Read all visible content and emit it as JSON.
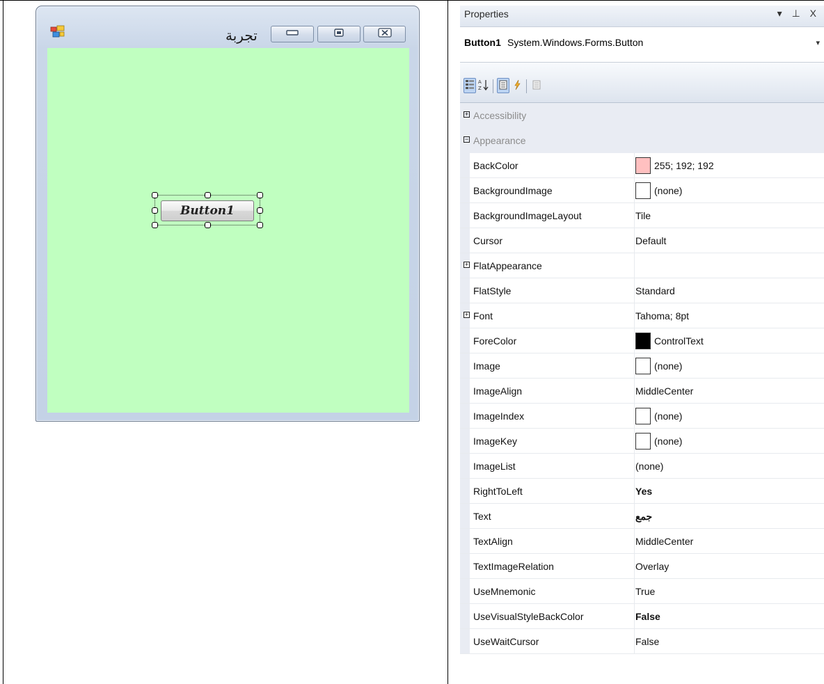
{
  "form": {
    "title": "تجربة",
    "button_text": "Button1",
    "client_color": "#C0FFC0"
  },
  "properties_panel": {
    "title": "Properties",
    "header_icons": "▾ ⊥ X",
    "selected_object_name": "Button1",
    "selected_object_type": "System.Windows.Forms.Button",
    "dropdown_arrow": "▾",
    "toolbar_icons": [
      "categorized-icon",
      "alphabetical-icon",
      "properties-icon",
      "events-icon",
      "property-pages-icon"
    ],
    "rows": [
      {
        "kind": "category",
        "expander": "+",
        "label": "Accessibility"
      },
      {
        "kind": "category",
        "expander": "−",
        "label": "Appearance"
      },
      {
        "kind": "prop",
        "name": "BackColor",
        "value": "255; 192; 192",
        "swatch": "#FFC0C0",
        "bold": false
      },
      {
        "kind": "prop",
        "name": "BackgroundImage",
        "value": "(none)",
        "swatch": "#FFFFFF",
        "bold": false
      },
      {
        "kind": "prop",
        "name": "BackgroundImageLayout",
        "value": "Tile",
        "bold": false
      },
      {
        "kind": "prop",
        "name": "Cursor",
        "value": "Default",
        "bold": false
      },
      {
        "kind": "prop",
        "name": "FlatAppearance",
        "value": "",
        "expander": "+",
        "bold": false
      },
      {
        "kind": "prop",
        "name": "FlatStyle",
        "value": "Standard",
        "bold": false
      },
      {
        "kind": "prop",
        "name": "Font",
        "value": "Tahoma; 8pt",
        "expander": "+",
        "bold": false
      },
      {
        "kind": "prop",
        "name": "ForeColor",
        "value": "ControlText",
        "swatch": "#000000",
        "bold": false
      },
      {
        "kind": "prop",
        "name": "Image",
        "value": "(none)",
        "swatch": "#FFFFFF",
        "bold": false
      },
      {
        "kind": "prop",
        "name": "ImageAlign",
        "value": "MiddleCenter",
        "bold": false
      },
      {
        "kind": "prop",
        "name": "ImageIndex",
        "value": "(none)",
        "swatch": "#FFFFFF",
        "bold": false
      },
      {
        "kind": "prop",
        "name": "ImageKey",
        "value": "(none)",
        "swatch": "#FFFFFF",
        "bold": false
      },
      {
        "kind": "prop",
        "name": "ImageList",
        "value": "(none)",
        "bold": false
      },
      {
        "kind": "prop",
        "name": "RightToLeft",
        "value": "Yes",
        "bold": true
      },
      {
        "kind": "prop",
        "name": "Text",
        "value": "جمع",
        "bold": true
      },
      {
        "kind": "prop",
        "name": "TextAlign",
        "value": "MiddleCenter",
        "bold": false
      },
      {
        "kind": "prop",
        "name": "TextImageRelation",
        "value": "Overlay",
        "bold": false
      },
      {
        "kind": "prop",
        "name": "UseMnemonic",
        "value": "True",
        "bold": false
      },
      {
        "kind": "prop",
        "name": "UseVisualStyleBackColor",
        "value": "False",
        "bold": true
      },
      {
        "kind": "prop",
        "name": "UseWaitCursor",
        "value": "False",
        "bold": false
      }
    ]
  }
}
